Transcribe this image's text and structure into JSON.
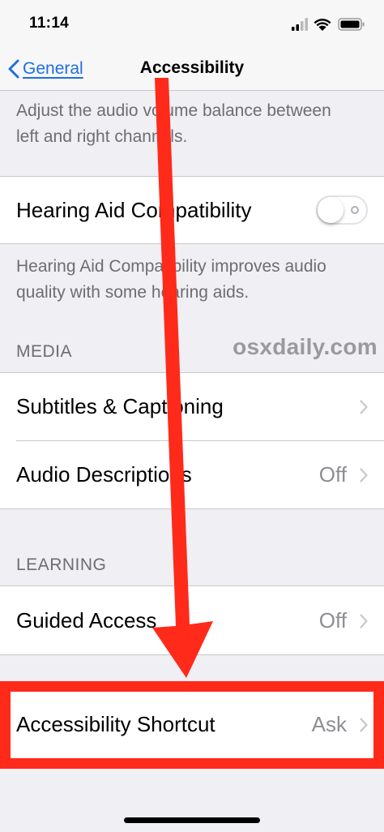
{
  "status_bar": {
    "time": "11:14"
  },
  "nav": {
    "back_label": "General",
    "title": "Accessibility"
  },
  "audio_balance_footer": "Adjust the audio volume balance between left and right channels.",
  "hearing_aid": {
    "label": "Hearing Aid Compatibility",
    "toggle_on": false,
    "footer": "Hearing Aid Compatibility improves audio quality with some hearing aids."
  },
  "media": {
    "header": "MEDIA",
    "items": [
      {
        "label": "Subtitles & Captioning",
        "value": ""
      },
      {
        "label": "Audio Descriptions",
        "value": "Off"
      }
    ]
  },
  "learning": {
    "header": "LEARNING",
    "items": [
      {
        "label": "Guided Access",
        "value": "Off"
      }
    ]
  },
  "shortcut": {
    "label": "Accessibility Shortcut",
    "value": "Ask"
  },
  "watermark": "osxdaily.com",
  "annotation": {
    "color": "#ff2a1a"
  },
  "colors": {
    "accent": "#1e6fe0",
    "background": "#efeff4",
    "secondary_text": "#8e8e93"
  },
  "icons": [
    "signal-icon",
    "wifi-icon",
    "battery-icon",
    "chevron-left-icon",
    "chevron-right-icon"
  ]
}
